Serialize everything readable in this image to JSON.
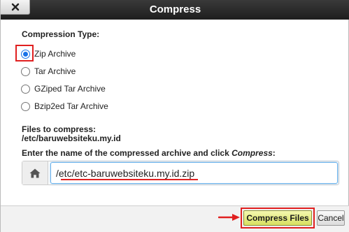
{
  "dialog": {
    "title": "Compress",
    "close_icon": "close-x-icon"
  },
  "compression": {
    "label": "Compression Type:",
    "selected": "Zip Archive",
    "options": [
      {
        "label": "Zip Archive",
        "checked": true
      },
      {
        "label": "Tar Archive",
        "checked": false
      },
      {
        "label": "GZiped Tar Archive",
        "checked": false
      },
      {
        "label": "Bzip2ed Tar Archive",
        "checked": false
      }
    ]
  },
  "files": {
    "label": "Files to compress:",
    "value": "/etc/baruwebsiteku.my.id"
  },
  "archive": {
    "instruction_prefix": "Enter the name of the compressed archive and click ",
    "instruction_emphasis": "Compress",
    "instruction_suffix": ":",
    "addon_icon": "home-icon",
    "value": "/etc/etc-baruwebsiteku.my.id.zip"
  },
  "footer": {
    "compress_label": "Compress Files",
    "cancel_label": "Cancel"
  },
  "colors": {
    "annotation": "#e02020",
    "compress_button": "#e4ea7a",
    "titlebar": "#2a2a2a",
    "radio_selected": "#1a73e8"
  }
}
